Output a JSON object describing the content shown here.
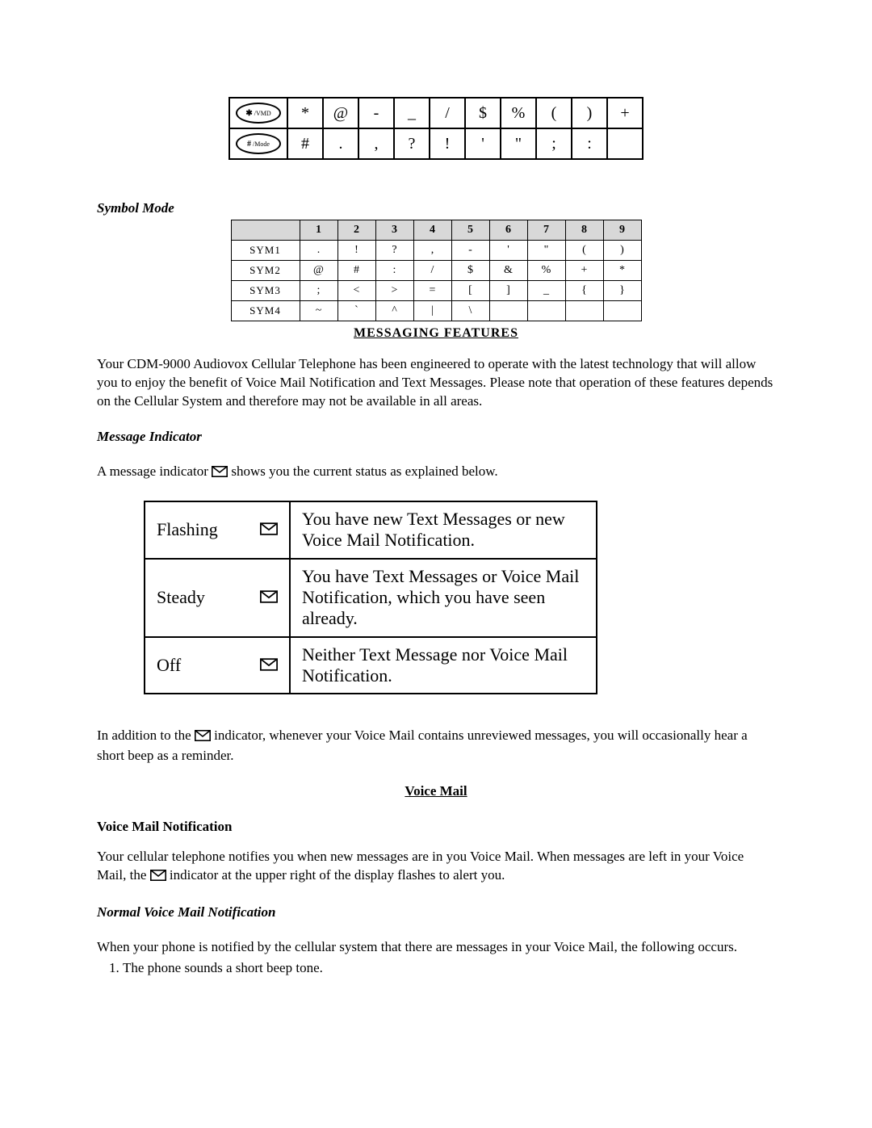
{
  "key_rows": [
    {
      "cap_sym": "✱",
      "cap_label": "/VMD",
      "cells": [
        "*",
        "@",
        "-",
        "_",
        "/",
        "$",
        "%",
        "(",
        ")",
        "+"
      ]
    },
    {
      "cap_sym": "#",
      "cap_label": "/Mode",
      "cells": [
        "#",
        ".",
        ",",
        "?",
        "!",
        "'",
        "\"",
        ";",
        ":",
        ""
      ]
    }
  ],
  "symbol_mode": {
    "heading": "Symbol Mode",
    "headers": [
      "",
      "1",
      "2",
      "3",
      "4",
      "5",
      "6",
      "7",
      "8",
      "9"
    ],
    "rows": [
      {
        "label": "SYM1",
        "cells": [
          ".",
          "!",
          "?",
          ",",
          "-",
          "'",
          "\"",
          "(",
          ")"
        ]
      },
      {
        "label": "SYM2",
        "cells": [
          "@",
          "#",
          ":",
          "/",
          "$",
          "&",
          "%",
          "+",
          "*"
        ]
      },
      {
        "label": "SYM3",
        "cells": [
          ";",
          "<",
          ">",
          "=",
          "[",
          "]",
          "_",
          "{",
          "}"
        ]
      },
      {
        "label": "SYM4",
        "cells": [
          "~",
          "`",
          "^",
          "|",
          "\\",
          "",
          "",
          "",
          ""
        ]
      }
    ],
    "caption": "MESSAGING FEATURES"
  },
  "intro_para": "Your CDM-9000 Audiovox Cellular Telephone has been engineered to operate with the latest technology that will allow you to enjoy the benefit of Voice Mail Notification and Text Messages.  Please note that operation of these features depends on the Cellular System and therefore may not be available in all areas.",
  "msg_indicator": {
    "heading": "Message Indicator",
    "lead_before": "A message indicator",
    "lead_after": "shows you the current status as explained below.",
    "rows": [
      {
        "state": "Flashing",
        "desc": "You have new Text Messages or new Voice Mail Notification."
      },
      {
        "state": "Steady",
        "desc": "You have Text Messages or Voice Mail Notification, which you have seen already."
      },
      {
        "state": "Off",
        "desc": "Neither Text Message nor Voice Mail Notification."
      }
    ],
    "after_para_before": "In addition to the",
    "after_para_after": "indicator, whenever your Voice Mail contains unreviewed messages, you will occasionally hear a short beep as a reminder."
  },
  "voice_mail": {
    "heading": "Voice Mail",
    "sub1": "Voice Mail Notification",
    "para1_before": "Your cellular telephone notifies you when new messages are in you Voice Mail.  When messages are left in your Voice Mail, the",
    "para1_after": "indicator at the upper right of the display flashes to alert you.",
    "sub2": "Normal Voice Mail Notification",
    "para2": "When your phone is notified by the cellular system that there are messages in your Voice Mail, the following occurs.",
    "list_item1": "The phone sounds a short beep tone."
  }
}
